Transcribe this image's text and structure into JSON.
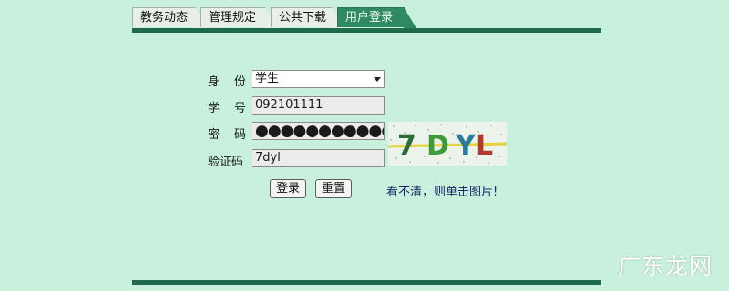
{
  "tabs": [
    {
      "label": "教务动态",
      "active": false
    },
    {
      "label": "管理规定",
      "active": false
    },
    {
      "label": "公共下载",
      "active": false
    },
    {
      "label": "用户登录",
      "active": true
    }
  ],
  "form": {
    "identity_label": "身份",
    "identity_value": "学生",
    "student_id_label": "学号",
    "student_id_value": "092101111",
    "password_label": "密码",
    "password_masked": "●●●●●●●●●●●●",
    "captcha_label": "验证码",
    "captcha_value": "7dyl",
    "captcha_image": {
      "chars": [
        {
          "ch": "7",
          "color": "#2e6b3a"
        },
        {
          "ch": "D",
          "color": "#3f9a3c"
        },
        {
          "ch": "Y",
          "color": "#2a7a9a"
        },
        {
          "ch": "L",
          "color": "#b03a2e"
        }
      ]
    }
  },
  "buttons": {
    "login": "登录",
    "reset": "重置"
  },
  "refresh_hint": "看不清，则单击图片!",
  "watermark": "广东龙网",
  "colors": {
    "background": "#c8f0dc",
    "rule": "#1f6a4a",
    "active_tab": "#2f8a62"
  }
}
